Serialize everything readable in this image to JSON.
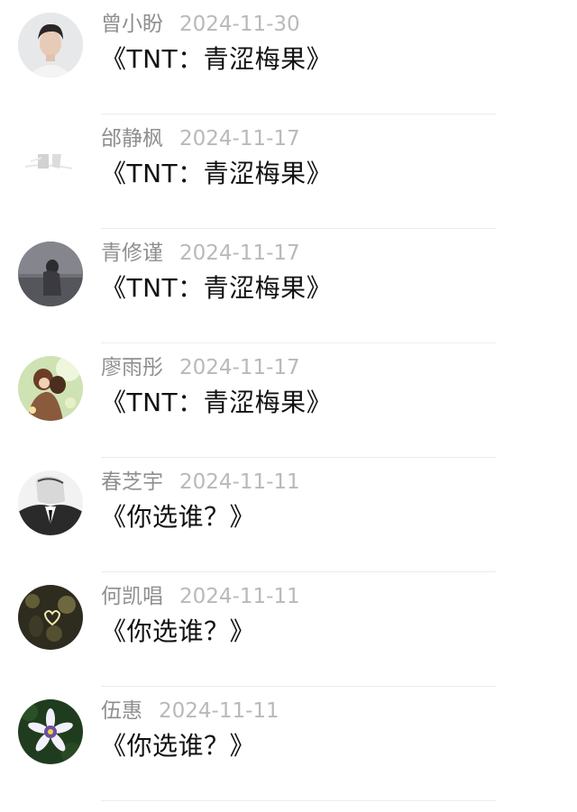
{
  "comments": [
    {
      "user": "曾小盼",
      "date": "2024-11-30",
      "title": "《TNT：青涩梅果》",
      "avatar_icon": "avatar-young-man"
    },
    {
      "user": "邰静枫",
      "date": "2024-11-17",
      "title": "《TNT：青涩梅果》",
      "avatar_icon": "avatar-light-sketch"
    },
    {
      "user": "青修谨",
      "date": "2024-11-17",
      "title": "《TNT：青涩梅果》",
      "avatar_icon": "avatar-dark-figure"
    },
    {
      "user": "廖雨彤",
      "date": "2024-11-17",
      "title": "《TNT：青涩梅果》",
      "avatar_icon": "avatar-anime-couple"
    },
    {
      "user": "春芝宇",
      "date": "2024-11-11",
      "title": "《你选谁？》",
      "avatar_icon": "avatar-manga-suit"
    },
    {
      "user": "何凯唱",
      "date": "2024-11-11",
      "title": "《你选谁？》",
      "avatar_icon": "avatar-bokeh-heart"
    },
    {
      "user": "伍惠",
      "date": "2024-11-11",
      "title": "《你选谁？》",
      "avatar_icon": "avatar-purple-flower"
    }
  ]
}
